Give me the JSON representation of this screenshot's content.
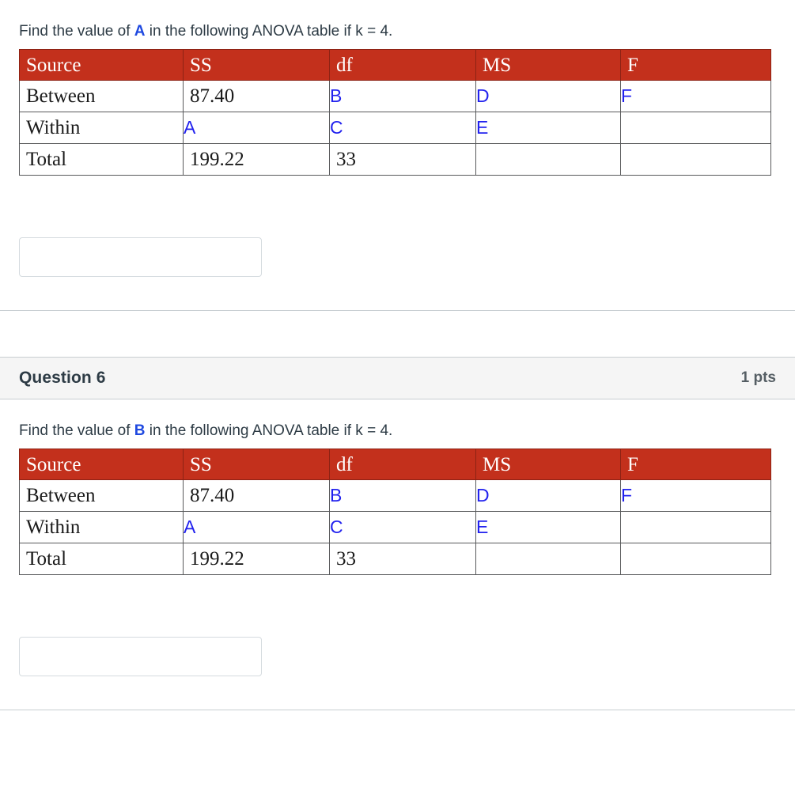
{
  "questions": [
    {
      "header_visible": false,
      "name": "",
      "points": "",
      "prompt": {
        "before": "Find the value of ",
        "variable": "A",
        "after": " in the following ANOVA table if k = 4."
      },
      "table": {
        "headers": [
          "Source",
          "SS",
          "df",
          "MS",
          "F"
        ],
        "rows": [
          {
            "source": "Between",
            "ss": "87.40",
            "df": "B",
            "ms": "D",
            "f": "F"
          },
          {
            "source": "Within",
            "ss": "A",
            "df": "C",
            "ms": "E",
            "f": ""
          },
          {
            "source": "Total",
            "ss": "199.22",
            "df": "33",
            "ms": "",
            "f": ""
          }
        ]
      },
      "answer": {
        "value": "",
        "placeholder": ""
      }
    },
    {
      "header_visible": true,
      "name": "Question 6",
      "points": "1 pts",
      "prompt": {
        "before": "Find the value of ",
        "variable": "B",
        "after": " in the following ANOVA table if k = 4."
      },
      "table": {
        "headers": [
          "Source",
          "SS",
          "df",
          "MS",
          "F"
        ],
        "rows": [
          {
            "source": "Between",
            "ss": "87.40",
            "df": "B",
            "ms": "D",
            "f": "F"
          },
          {
            "source": "Within",
            "ss": "A",
            "df": "C",
            "ms": "E",
            "f": ""
          },
          {
            "source": "Total",
            "ss": "199.22",
            "df": "33",
            "ms": "",
            "f": ""
          }
        ]
      },
      "answer": {
        "value": "",
        "placeholder": ""
      }
    }
  ],
  "colors": {
    "table_header_bg": "#C3301C",
    "variable_text": "#1F49E0",
    "blue_cell_text": "#2222EE",
    "question_header_bg": "#F5F5F5",
    "divider": "#C7CDD1"
  }
}
